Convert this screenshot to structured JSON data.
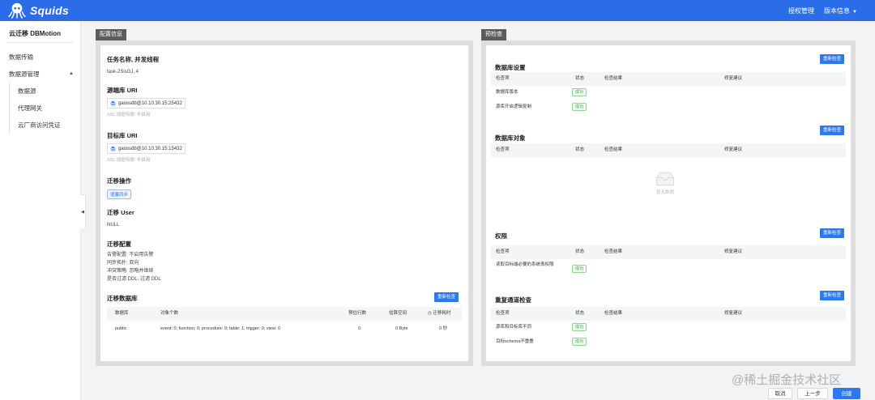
{
  "header": {
    "app_name": "Squids",
    "nav": [
      "授权管理",
      "版本信息"
    ]
  },
  "sidebar": {
    "title": "云迁移 DBMotion",
    "items": [
      {
        "label": "数据传输"
      },
      {
        "label": "数据源管理"
      }
    ],
    "sub_items": [
      {
        "label": "数据源"
      },
      {
        "label": "代理网关"
      },
      {
        "label": "云厂商访问凭证"
      }
    ]
  },
  "config_panel": {
    "tab": "配置信息",
    "task": {
      "title": "任务名称, 并发线程",
      "value": "task-2SisGJ, 4"
    },
    "source": {
      "title": "源端库 URI",
      "uri": "gaussdb@10.10.30.15:25432",
      "ssl": "SSL 加密传输: 不启用"
    },
    "target": {
      "title": "目标库 URI",
      "uri": "gaussdb@10.10.30.15:15432",
      "ssl": "SSL 加密传输: 不启用"
    },
    "operation": {
      "title": "迁移操作",
      "tag": "增量同步"
    },
    "user": {
      "title": "迁移 User",
      "value": "NULL"
    },
    "migration_config": {
      "title": "迁移配置",
      "lines": [
        "告警配置: 不启用告警",
        "同步拓扑: 双向",
        "冲突策略: 忽略并继续",
        "是否过滤 DDL: 过滤 DDL"
      ]
    },
    "databases": {
      "title": "迁移数据库",
      "recheck": "重新检查",
      "headers": [
        "数据库",
        "对象个数",
        "预估行数",
        "估算空间",
        "迁移耗时"
      ],
      "rows": [
        {
          "db": "public",
          "objects": "event: 0; function: 0; procedure: 0; table: 1; trigger: 0; view: 0",
          "rows": "0",
          "space": "0 Byte",
          "time": "0 秒"
        }
      ]
    }
  },
  "precheck_panel": {
    "tab": "预检查",
    "headers": [
      "检查项",
      "状态",
      "检查结果",
      "修复建议"
    ],
    "sections": [
      {
        "title": "数据库设置",
        "recheck": "重新检查",
        "rows": [
          {
            "item": "数据库版本",
            "status": "成功"
          },
          {
            "item": "源库开启逻辑复制",
            "status": "成功"
          }
        ]
      },
      {
        "title": "数据库对象",
        "recheck": "重新检查",
        "empty": "暂无数据"
      },
      {
        "title": "权限",
        "recheck": "重新检查",
        "rows": [
          {
            "item": "读取目标端必要的系统表权限",
            "status": "成功"
          }
        ]
      },
      {
        "title": "重复通道检查",
        "recheck": "重新检查",
        "rows": [
          {
            "item": "源库和目标库不同",
            "status": "成功"
          },
          {
            "item": "目标schema不重叠",
            "status": "成功"
          }
        ]
      }
    ]
  },
  "footer": {
    "cancel": "取消",
    "prev": "上一步",
    "create": "创建"
  },
  "watermark": "@稀土掘金技术社区",
  "colors": {
    "primary": "#2b6de8",
    "success": "#3fa64a"
  }
}
